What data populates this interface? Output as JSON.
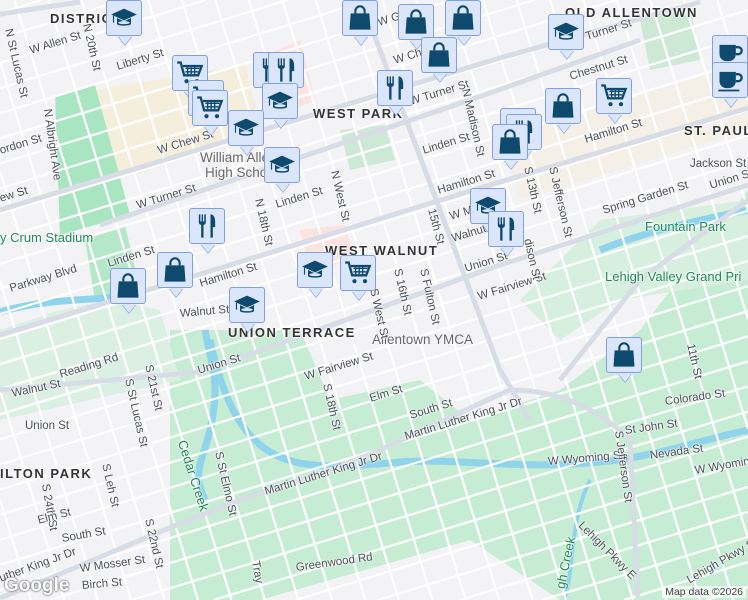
{
  "map": {
    "neighborhoods": [
      "DISTRICT",
      "WEST PARK",
      "WEST WALNUT",
      "UNION TERRACE",
      "OLD ALLENTOWN",
      "ST. PAUL",
      "ILTON PARK"
    ],
    "parks": [
      "y Crum Stadium",
      "Fountain Park",
      "Lehigh Valley Grand Pri",
      "Cedar Creek",
      "gh Creek"
    ],
    "pois": [
      "William Allen",
      "High School",
      "Allentown YMCA"
    ],
    "streets": [
      "W Allen St",
      "N 20th St",
      "N St Lucas St",
      "Liberty St",
      "N Albright Ave",
      "ordon St",
      "W Chew St",
      "ew St",
      "W Turner St",
      "Linden St",
      "N 18th St",
      "N West St",
      "Linden St",
      "Parkway Blvd",
      "Hamilton St",
      "Walnut St",
      "Union St",
      "W Fairview St",
      "Reading Rd",
      "Walnut St",
      "S St Lucas St",
      "S 21st St",
      "Union St",
      "S 18th St",
      "Elm St",
      "South St",
      "S West St",
      "S 16th St",
      "S Fulton St",
      "W Fairview St",
      "Union St",
      "Martin Luther King Jr Dr",
      "Martin Luther King Jr Dr",
      "uther King Jr Dr",
      "S St Elmo St",
      "S 24th St",
      "Elm St",
      "S Leh St",
      "S 22nd St",
      "South St",
      "W Mosser St",
      "Birch St",
      "Greenwood Rd",
      "Tray",
      "Lehigh Pkwy E",
      "Lehigh Pkwy S",
      "W Wyoming St",
      "W Wyoming S",
      "Nevada St",
      "St John St",
      "Colorado St",
      "11th St",
      "S Jefferson St",
      "Spring Garden St",
      "Union St",
      "Jackson St",
      "Hamilton St",
      "S Jefferson St",
      "S 13th St",
      "Linden St",
      "N Madison St",
      "W Turner St",
      "Chestnut St",
      "Turner St",
      "Hamilton St",
      "15th St",
      "W Ma",
      "Walnut St",
      "dison St",
      "W Ch",
      "W G",
      "Hamilton St"
    ]
  },
  "marker_types": [
    "shopping-cart-icon",
    "restaurant-icon",
    "school-icon",
    "shopping-bag-icon",
    "coffee-icon"
  ],
  "attribution": "Map data ©2026",
  "logo": "Google"
}
